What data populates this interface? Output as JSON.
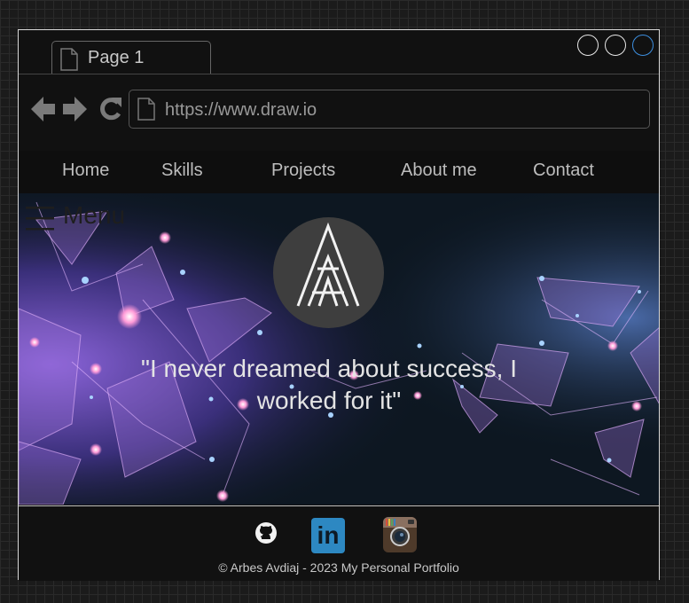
{
  "browser": {
    "tab_label": "Page 1",
    "url": "https://www.draw.io"
  },
  "nav": {
    "items": [
      "Home",
      "Skills",
      "Projects",
      "About me",
      "Contact"
    ]
  },
  "hero": {
    "menu_label": "Menu",
    "quote_line1": "\"I never dreamed about success, I",
    "quote_line2": "worked for it\""
  },
  "footer": {
    "copyright": "© Arbes Avdiaj - 2023 My Personal Portfolio",
    "linkedin_label": "in",
    "social_icons": [
      "github-icon",
      "linkedin-icon",
      "instagram-icon"
    ]
  },
  "colors": {
    "page_background": "#1b1b1b",
    "frame_background": "#111111",
    "close_button_border": "#3d8fe0",
    "linkedin_blue": "#2d88c2"
  }
}
